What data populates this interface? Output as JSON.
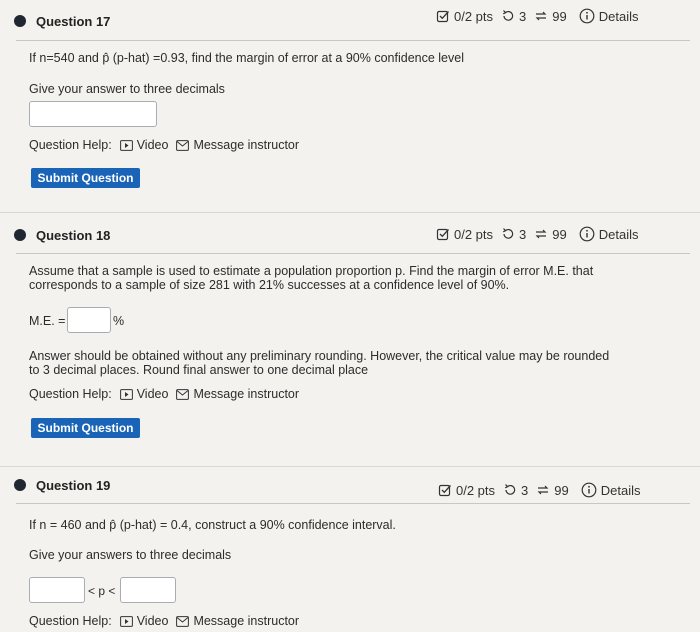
{
  "q17": {
    "title": "Question 17",
    "pts": "0/2 pts",
    "retries": "3",
    "attempts": "99",
    "details": "Details",
    "prompt": "If n=540 and p̂ (p-hat) =0.93, find the margin of error at a 90% confidence level",
    "instruction": "Give your answer to three decimals",
    "help_label": "Question Help:",
    "video": "Video",
    "message": "Message instructor",
    "submit": "Submit Question"
  },
  "q18": {
    "title": "Question 18",
    "pts": "0/2 pts",
    "retries": "3",
    "attempts": "99",
    "details": "Details",
    "prompt_line1": "Assume that a sample is used to estimate a population proportion p. Find the margin of error M.E. that",
    "prompt_line2": "corresponds to a sample of size 281 with 21% successes at a confidence level of 90%.",
    "me_label": "M.E. =",
    "percent": "%",
    "note_line1": "Answer should be obtained without any preliminary rounding. However, the critical value may be rounded",
    "note_line2": "to 3 decimal places. Round final answer to one decimal place",
    "help_label": "Question Help:",
    "video": "Video",
    "message": "Message instructor",
    "submit": "Submit Question"
  },
  "q19": {
    "title": "Question 19",
    "pts": "0/2 pts",
    "retries": "3",
    "attempts": "99",
    "details": "Details",
    "prompt": "If n = 460 and p̂ (p-hat) = 0.4, construct a 90% confidence interval.",
    "instruction": "Give your answers to three decimals",
    "between": "< p <",
    "help_label": "Question Help:",
    "video": "Video",
    "message": "Message instructor"
  }
}
